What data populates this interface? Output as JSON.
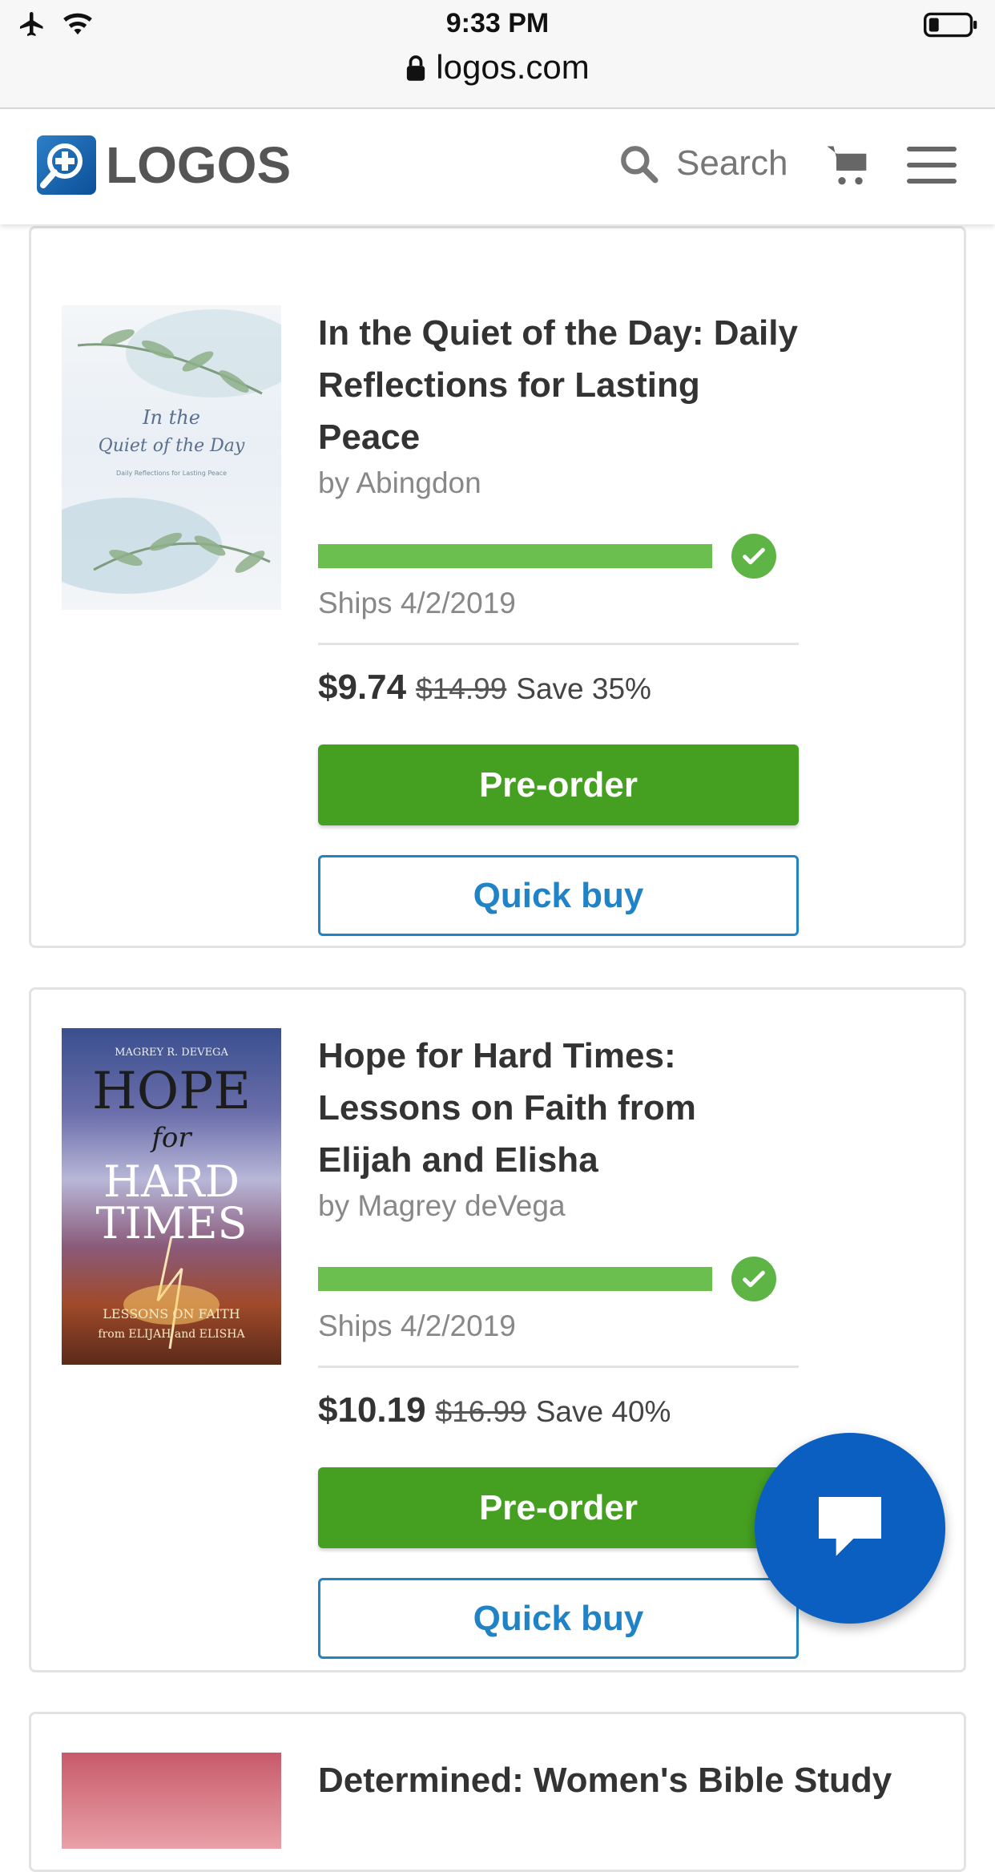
{
  "status_bar": {
    "time": "9:33 PM",
    "url": "logos.com",
    "icons": [
      "airplane-icon",
      "wifi-icon",
      "lock-icon",
      "battery-icon"
    ]
  },
  "header": {
    "logo_text": "LOGOS",
    "search_label": "Search",
    "icons": [
      "search-icon",
      "cart-icon",
      "menu-icon"
    ]
  },
  "colors": {
    "brand_blue": "#1f83c6",
    "preorder_green": "#45a021",
    "progress_green": "#6bbf4e",
    "chat_blue": "#0b5fc0"
  },
  "products": [
    {
      "title": "In the Quiet of the Day: Daily Reflections for Lasting Peace",
      "author": "by Abingdon",
      "ship_progress": 1.0,
      "ships": "Ships 4/2/2019",
      "price": "$9.74",
      "old_price": "$14.99",
      "save": "Save 35%",
      "preorder_label": "Pre-order",
      "quickbuy_label": "Quick buy",
      "cover": {
        "line1": "In the",
        "line2": "Quiet of the Day",
        "sub": "Daily Reflections for Lasting Peace"
      }
    },
    {
      "title": "Hope for Hard Times: Lessons on Faith from Elijah and Elisha",
      "author": "by Magrey deVega",
      "ship_progress": 1.0,
      "ships": "Ships 4/2/2019",
      "price": "$10.19",
      "old_price": "$16.99",
      "save": "Save 40%",
      "preorder_label": "Pre-order",
      "quickbuy_label": "Quick buy",
      "cover": {
        "author": "MAGREY R. DEVEGA",
        "w1": "HOPE",
        "w2": "for",
        "w3": "HARD",
        "w4": "TIMES",
        "sub1": "LESSONS ON FAITH",
        "sub2": "from ELIJAH and ELISHA"
      }
    },
    {
      "title": "Determined: Women's Bible Study"
    }
  ]
}
